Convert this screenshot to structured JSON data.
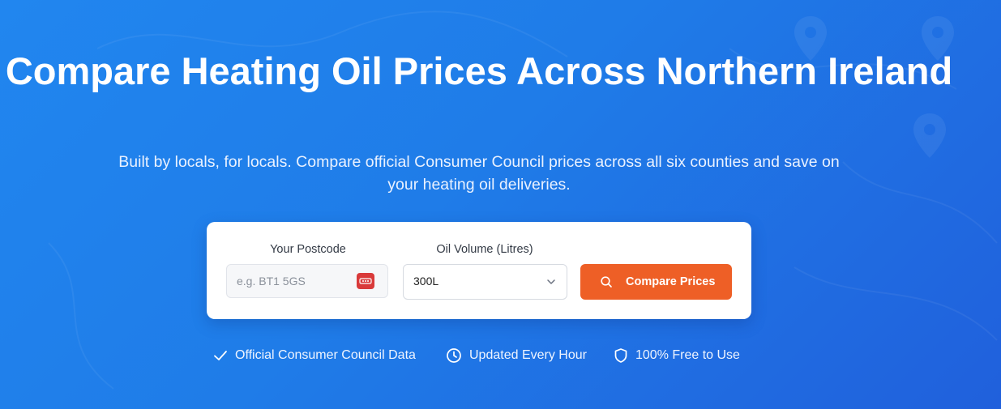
{
  "hero": {
    "title": "Compare Heating Oil Prices Across Northern Ireland",
    "subtitle": "Built by locals, for locals. Compare official Consumer Council prices across all six counties and save on your heating oil deliveries."
  },
  "search_form": {
    "postcode_label": "Your Postcode",
    "postcode_placeholder": "e.g. BT1 5GS",
    "postcode_value": "",
    "volume_label": "Oil Volume (Litres)",
    "volume_selected": "300L",
    "submit_label": "Compare Prices"
  },
  "features": [
    {
      "icon": "check-icon",
      "label": "Official Consumer Council Data"
    },
    {
      "icon": "clock-icon",
      "label": "Updated Every Hour"
    },
    {
      "icon": "shield-icon",
      "label": "100% Free to Use"
    }
  ],
  "colors": {
    "background_start": "#2186ef",
    "background_end": "#2060dc",
    "accent_button": "#ee5f26",
    "password_manager_icon": "#d93a3a"
  }
}
